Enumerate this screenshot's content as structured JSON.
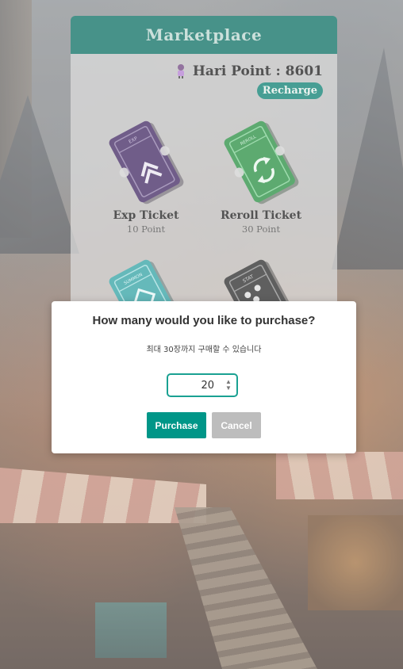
{
  "market": {
    "title": "Marketplace",
    "points_label": "Hari Point : 8601",
    "recharge_label": "Recharge",
    "products": [
      {
        "name": "Exp Ticket",
        "price": "10 Point",
        "ticket_tag": "EXP",
        "color": "#3a1f5c"
      },
      {
        "name": "Reroll Ticket",
        "price": "30 Point",
        "ticket_tag": "REROLL",
        "color": "#1f8a3a"
      },
      {
        "name": "",
        "price": "",
        "ticket_tag": "SUMMON",
        "color": "#2a9ea0"
      },
      {
        "name": "",
        "price": "",
        "ticket_tag": "STAT",
        "color": "#222222"
      }
    ]
  },
  "modal": {
    "title": "How many would you like to purchase?",
    "subtitle": "최대 30장까지 구매할 수 있습니다",
    "quantity_value": "20",
    "purchase_label": "Purchase",
    "cancel_label": "Cancel"
  },
  "colors": {
    "accent": "#009688",
    "header": "#00695c",
    "cancel": "#bdbdbd"
  }
}
